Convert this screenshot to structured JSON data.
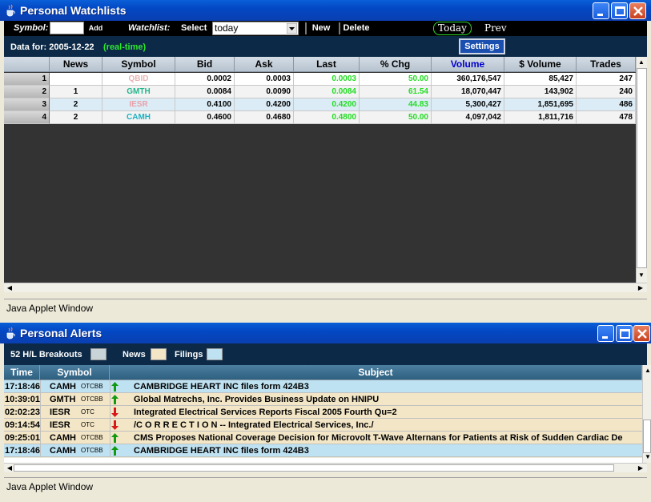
{
  "watchlist_window": {
    "title": "Personal Watchlists",
    "toolbar": {
      "symbol_label": "Symbol:",
      "symbol_value": "",
      "add_label": "Add",
      "watchlist_label": "Watchlist:",
      "select_label": "Select",
      "watchlist_selected": "today",
      "new_label": "New",
      "delete_label": "Delete",
      "today_label": "Today",
      "prev_label": "Prev"
    },
    "info": {
      "data_for_label": "Data for: 2005-12-22",
      "realtime_label": "(real-time)",
      "settings_label": "Settings"
    },
    "columns": [
      "News",
      "Symbol",
      "Bid",
      "Ask",
      "Last",
      "% Chg",
      "Volume",
      "$ Volume",
      "Trades"
    ],
    "rows": [
      {
        "num": "1",
        "news": "",
        "symbol": "QBID",
        "bid": "0.0002",
        "ask": "0.0003",
        "last": "0.0003",
        "chg": "50.00",
        "volume": "360,176,547",
        "dvolume": "85,427",
        "trades": "247",
        "color": "#e8b3b3",
        "bg": "#ffffff"
      },
      {
        "num": "2",
        "news": "1",
        "symbol": "GMTH",
        "bid": "0.0084",
        "ask": "0.0090",
        "last": "0.0084",
        "chg": "61.54",
        "volume": "18,070,447",
        "dvolume": "143,902",
        "trades": "240",
        "color": "#22b58c",
        "bg": "#f3f3f3"
      },
      {
        "num": "3",
        "news": "2",
        "symbol": "IESR",
        "bid": "0.4100",
        "ask": "0.4200",
        "last": "0.4200",
        "chg": "44.83",
        "volume": "5,300,427",
        "dvolume": "1,851,695",
        "trades": "486",
        "color": "#e8a0a8",
        "bg": "#dbecf6"
      },
      {
        "num": "4",
        "news": "2",
        "symbol": "CAMH",
        "bid": "0.4600",
        "ask": "0.4680",
        "last": "0.4800",
        "chg": "50.00",
        "volume": "4,097,042",
        "dvolume": "1,811,716",
        "trades": "478",
        "color": "#1fb0c0",
        "bg": "#f3f3f3"
      }
    ],
    "status": "Java Applet Window"
  },
  "alerts_window": {
    "title": "Personal Alerts",
    "legend": {
      "breakouts_label": "52 H/L Breakouts",
      "news_label": "News",
      "filings_label": "Filings",
      "breakouts_color": "#c8d4d8",
      "news_color": "#f3e6c6",
      "filings_color": "#bfe2f2"
    },
    "columns": [
      "Time",
      "Symbol",
      "Subject"
    ],
    "rows": [
      {
        "time": "17:18:46",
        "symbol": "CAMH",
        "exch": "OTCBB",
        "dir": "up",
        "subject": "CAMBRIDGE HEART INC files form 424B3",
        "bg": "#bfe2f2"
      },
      {
        "time": "10:39:01",
        "symbol": "GMTH",
        "exch": "OTCBB",
        "dir": "up",
        "subject": "Global Matrechs, Inc. Provides Business Update on HNIPU",
        "bg": "#f3e6c6"
      },
      {
        "time": "02:02:23",
        "symbol": "IESR",
        "exch": "OTC",
        "dir": "down",
        "subject": "Integrated Electrical Services Reports Fiscal 2005 Fourth Qu=2",
        "bg": "#f3e6c6"
      },
      {
        "time": "09:14:54",
        "symbol": "IESR",
        "exch": "OTC",
        "dir": "down",
        "subject": "/C O R R E C T I O N -- Integrated Electrical Services, Inc./",
        "bg": "#f3e6c6"
      },
      {
        "time": "09:25:01",
        "symbol": "CAMH",
        "exch": "OTCBB",
        "dir": "up",
        "subject": "CMS Proposes National Coverage Decision for Microvolt T-Wave Alternans for Patients at Risk of Sudden Cardiac De",
        "bg": "#f3e6c6"
      },
      {
        "time": "17:18:46",
        "symbol": "CAMH",
        "exch": "OTCBB",
        "dir": "up",
        "subject": "CAMBRIDGE HEART INC files form 424B3",
        "bg": "#bfe2f2"
      }
    ],
    "status": "Java Applet Window"
  }
}
